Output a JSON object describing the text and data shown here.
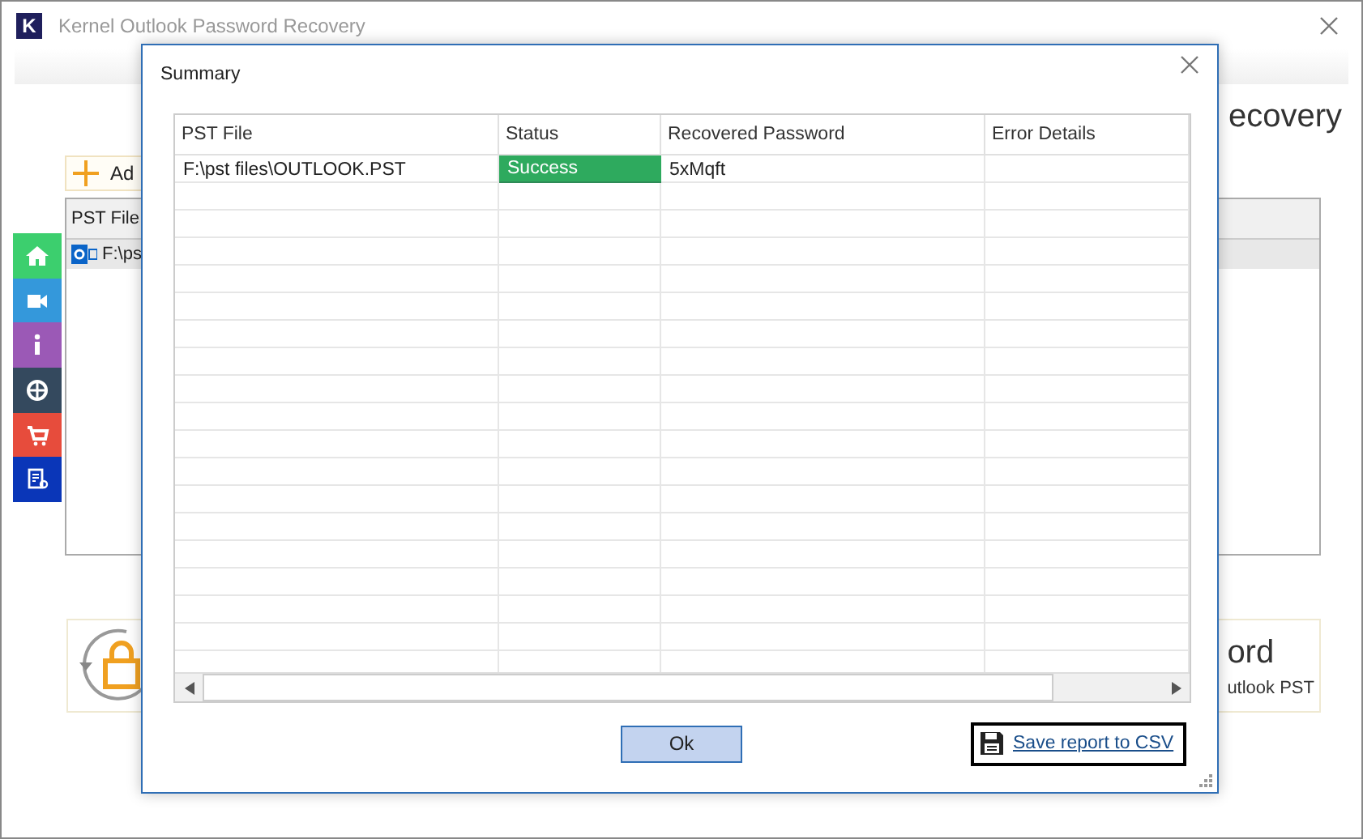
{
  "window": {
    "title": "Kernel Outlook Password Recovery",
    "logo_text": "K"
  },
  "background": {
    "heading": "ecovery",
    "add_button": "Ad",
    "file_list": {
      "column": "PST File",
      "rows": [
        {
          "file": "F:\\ps",
          "selected": true
        }
      ]
    },
    "sidebar": [
      {
        "kind": "home",
        "color": "#3ccf6e"
      },
      {
        "kind": "video",
        "color": "#3498db"
      },
      {
        "kind": "info",
        "color": "#9b59b6"
      },
      {
        "kind": "support",
        "color": "#34495e"
      },
      {
        "kind": "cart",
        "color": "#e74c3c"
      },
      {
        "kind": "license",
        "color": "#0a36b8"
      }
    ],
    "info_panel": {
      "title": "ord",
      "subtitle": "utlook PST"
    }
  },
  "dialog": {
    "title": "Summary",
    "columns": [
      "PST File",
      "Status",
      "Recovered Password",
      "Error Details"
    ],
    "rows": [
      {
        "pst_file": "F:\\pst files\\OUTLOOK.PST",
        "status": "Success",
        "color": "#2eaa5e",
        "recovered_password": "5xMqft"
      }
    ],
    "ok_button": "Ok",
    "save_link": "Save report to CSV"
  }
}
